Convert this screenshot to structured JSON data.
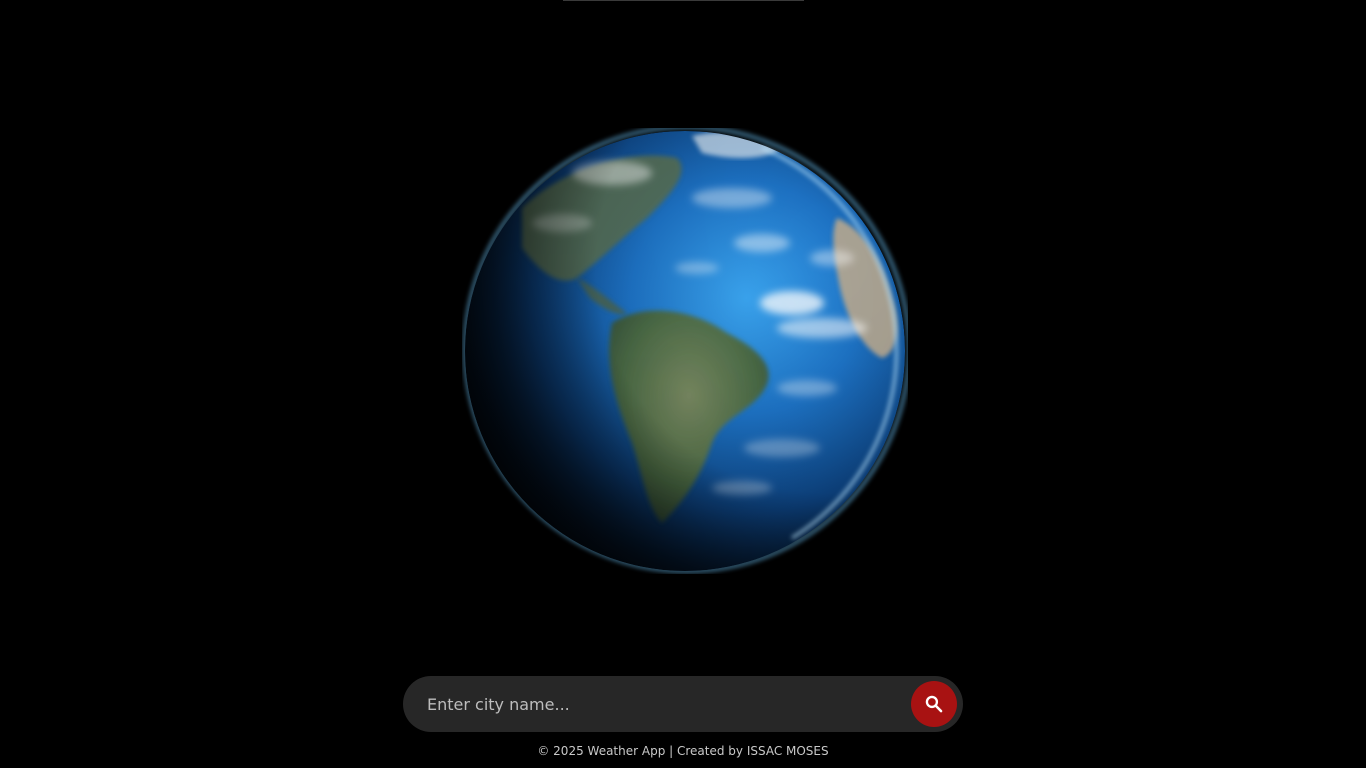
{
  "search": {
    "placeholder": "Enter city name...",
    "value": "",
    "button_icon": "search-icon"
  },
  "footer": {
    "text": "© 2025 Weather App | Created by ISSAC MOSES"
  },
  "colors": {
    "background": "#000000",
    "search_bar": "#272727",
    "search_button": "#a81212",
    "ocean": "#1b6fc0",
    "atmosphere": "#7fd2ff"
  }
}
